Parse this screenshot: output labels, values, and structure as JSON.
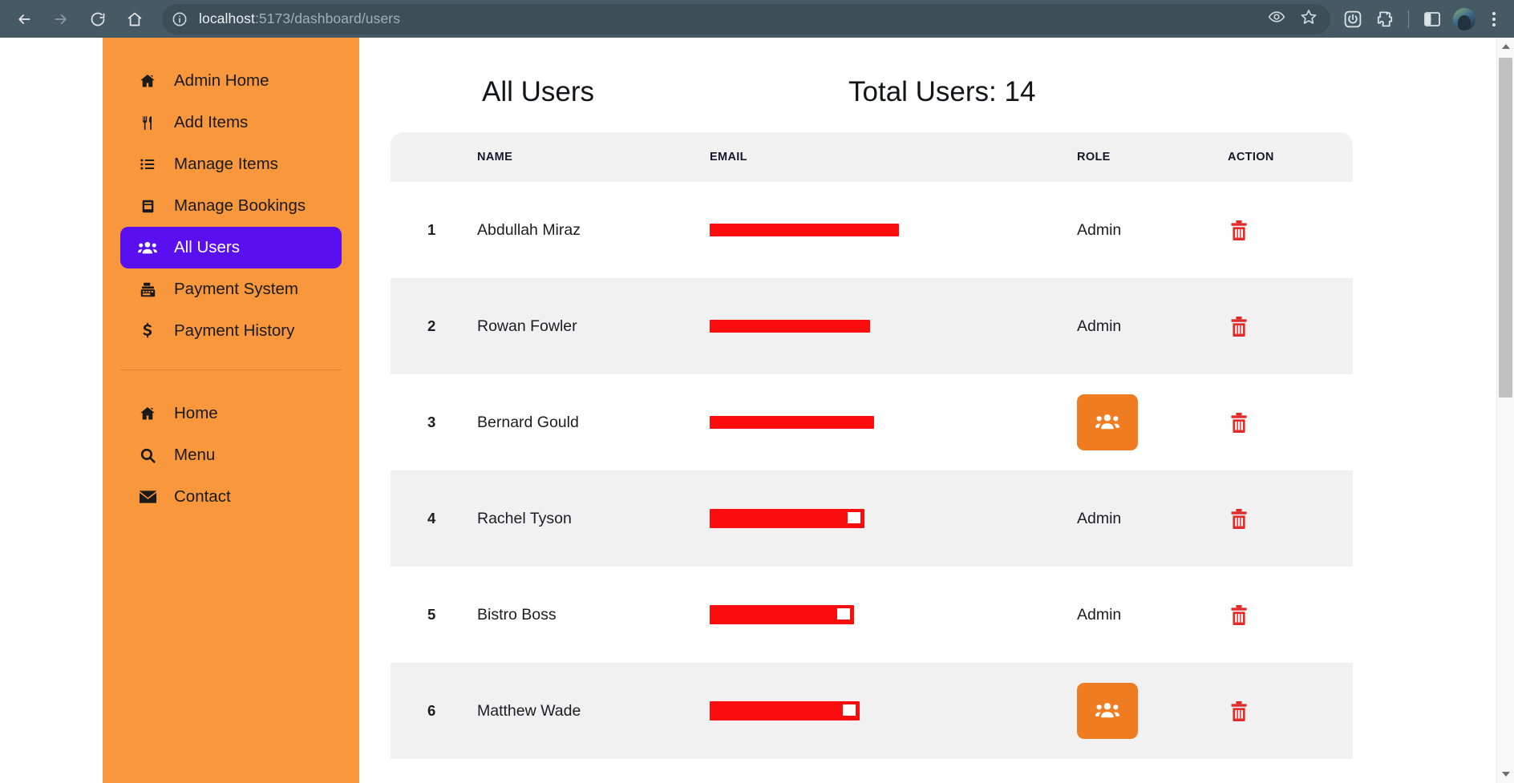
{
  "browser": {
    "back_label": "Back",
    "forward_label": "Forward",
    "reload_label": "Reload",
    "home_label": "Home",
    "url_host": "localhost",
    "url_path": ":5173/dashboard/users",
    "site_info_label": "View site information",
    "actions": [
      {
        "name": "eye-icon",
        "label": "Show password / preview"
      },
      {
        "name": "bookmark-star-icon",
        "label": "Bookmark this tab"
      }
    ],
    "toolbar": [
      {
        "name": "power-extension-icon",
        "label": "Power extension"
      },
      {
        "name": "puzzle-extensions-icon",
        "label": "Extensions"
      },
      {
        "name": "side-panel-icon",
        "label": "Side panel"
      },
      {
        "name": "profile-avatar",
        "label": "Profile"
      },
      {
        "name": "kebab-menu-icon",
        "label": "Customize and control"
      }
    ]
  },
  "sidebar": {
    "primary": [
      {
        "label": "Admin Home",
        "icon": "home-icon",
        "active": false
      },
      {
        "label": "Add Items",
        "icon": "utensils-icon",
        "active": false
      },
      {
        "label": "Manage Items",
        "icon": "list-icon",
        "active": false
      },
      {
        "label": "Manage Bookings",
        "icon": "book-icon",
        "active": false
      },
      {
        "label": "All Users",
        "icon": "users-icon",
        "active": true
      },
      {
        "label": "Payment System",
        "icon": "cash-register-icon",
        "active": false
      },
      {
        "label": "Payment History",
        "icon": "dollar-icon",
        "active": false
      }
    ],
    "secondary": [
      {
        "label": "Home",
        "icon": "home-icon",
        "active": false
      },
      {
        "label": "Menu",
        "icon": "search-icon",
        "active": false
      },
      {
        "label": "Contact",
        "icon": "envelope-icon",
        "active": false
      }
    ]
  },
  "main": {
    "title": "All Users",
    "total_users_label": "Total Users: 14",
    "total_users_count": 14,
    "columns": [
      "",
      "NAME",
      "EMAIL",
      "ROLE",
      "ACTION"
    ],
    "rows": [
      {
        "index": "1",
        "name": "Abdullah Miraz",
        "email": "[redacted]",
        "email_redacted": true,
        "email_width": 236,
        "email_style": "bar",
        "role": "Admin",
        "role_is_button": false,
        "action": "delete"
      },
      {
        "index": "2",
        "name": "Rowan Fowler",
        "email": "[redacted]",
        "email_redacted": true,
        "email_width": 200,
        "email_style": "bar",
        "role": "Admin",
        "role_is_button": false,
        "action": "delete"
      },
      {
        "index": "3",
        "name": "Bernard Gould",
        "email": "[redacted]",
        "email_redacted": true,
        "email_width": 205,
        "email_style": "bar",
        "role": "",
        "role_is_button": true,
        "action": "delete"
      },
      {
        "index": "4",
        "name": "Rachel Tyson",
        "email": "[redacted]",
        "email_redacted": true,
        "email_width": 193,
        "email_style": "boxed",
        "role": "Admin",
        "role_is_button": false,
        "action": "delete"
      },
      {
        "index": "5",
        "name": "Bistro Boss",
        "email": "[redacted]",
        "email_redacted": true,
        "email_width": 180,
        "email_style": "boxed",
        "role": "Admin",
        "role_is_button": false,
        "action": "delete"
      },
      {
        "index": "6",
        "name": "Matthew Wade",
        "email": "[redacted]",
        "email_redacted": true,
        "email_width": 187,
        "email_style": "boxed",
        "role": "",
        "role_is_button": true,
        "action": "delete"
      }
    ],
    "make_admin_label": "Make admin",
    "delete_label": "Delete user"
  },
  "colors": {
    "sidebar_orange": "#f8973c",
    "active_purple": "#5a0ff0",
    "role_button_orange": "#f07c22",
    "delete_red": "#e02b2b",
    "redaction_red": "#fb0d0d",
    "browser_chrome": "#455a64",
    "row_stripe": "#f1f1f1"
  },
  "scrollbar": {
    "position_percent": 3,
    "visible": true
  }
}
